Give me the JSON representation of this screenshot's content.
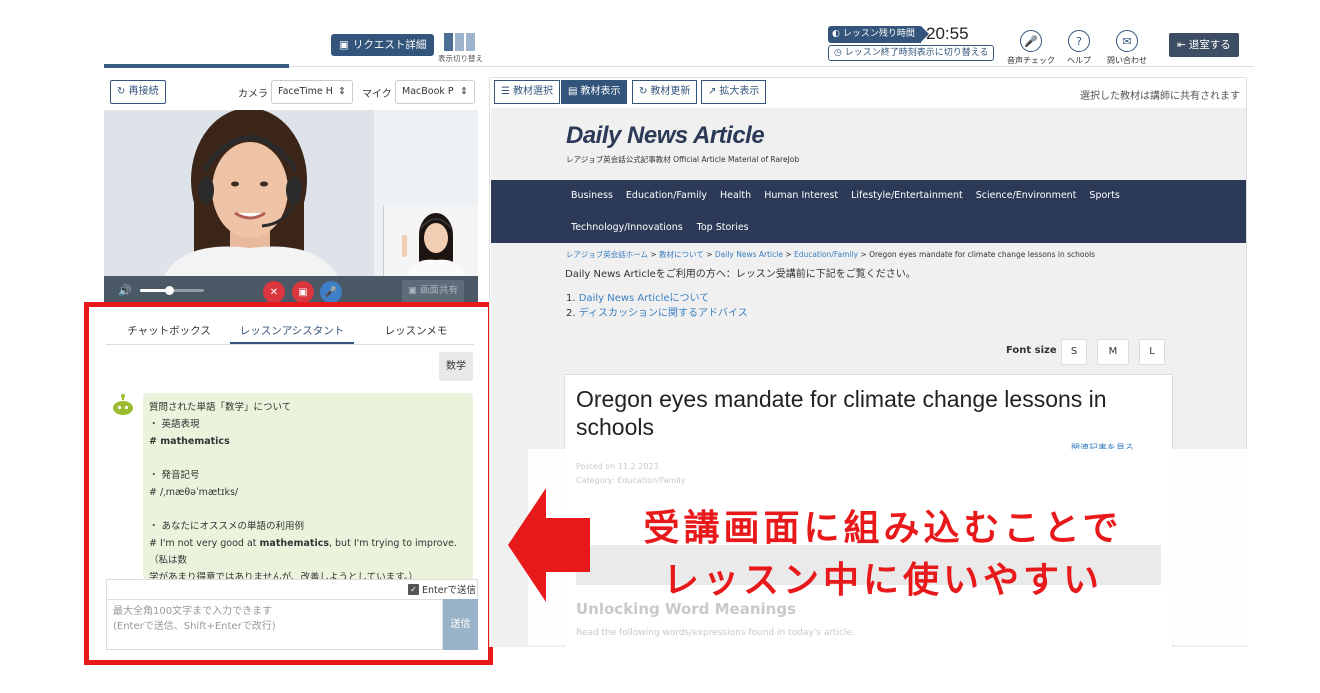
{
  "header": {
    "request_detail": "リクエスト詳細",
    "view_toggle": "表示切り替え",
    "remaining_label": "レッスン残り時間",
    "remaining_time": "20:55",
    "end_time_toggle": "レッスン終了時刻表示に切り替える",
    "audio_check": "音声チェック",
    "help": "ヘルプ",
    "contact": "問い合わせ",
    "exit": "退室する"
  },
  "video": {
    "reconnect": "再接続",
    "camera_label": "カメラ",
    "camera_value": "FaceTime H",
    "mic_label": "マイク",
    "mic_value": "MacBook P",
    "screen_share": "画面共有",
    "volume_level": 0.45
  },
  "chat": {
    "tabs": [
      "チャットボックス",
      "レッスンアシスタント",
      "レッスンメモ"
    ],
    "active_tab": "レッスンアシスタント",
    "user_message": "数学",
    "bot": {
      "line1": "質問された単語「数学」について",
      "line2": "・ 英語表現",
      "line3": "# mathematics",
      "line4": "・ 発音記号",
      "line5": "# /ˌmæθəˈmætɪks/",
      "line6": "・ あなたにオススメの単語の利用例",
      "line7_pre": "# I'm not very good at ",
      "line7_bold": "mathematics",
      "line7_post": ", but I'm trying to improve.（私は数",
      "line8": "学があまり得意ではありませんが、改善しようとしています。）"
    },
    "enter_send": "Enterで送信",
    "input_placeholder": "最大全角100文字まで入力できます\n(Enterで送信、Shift+Enterで改行)",
    "send": "送信"
  },
  "material": {
    "buttons": [
      "教材選択",
      "教材表示",
      "教材更新",
      "拡大表示"
    ],
    "share_note": "選択した教材は講師に共有されます",
    "logo": "Daily News Article",
    "logo_sub": "レアジョブ英会話公式記事教材   Official Article Material of RareJob",
    "categories_row1": [
      "Business",
      "Education/Family",
      "Health",
      "Human Interest",
      "Lifestyle/Entertainment",
      "Science/Environment",
      "Sports"
    ],
    "categories_row2": [
      "Technology/Innovations",
      "Top Stories"
    ],
    "breadcrumb": {
      "home": "レアジョブ英会話ホーム",
      "about": "教材について",
      "dna": "Daily News Article",
      "category": "Education/Family",
      "current": "Oregon eyes mandate for climate change lessons in schools"
    },
    "notice": "Daily News Articleをご利用の方へ：レッスン受講前に下記をご覧ください。",
    "guide": {
      "item1_num": "1.",
      "item1": "Daily News Articleについて",
      "item2_num": "2.",
      "item2": "ディスカッションに関するアドバイス"
    },
    "font_size_label": "Font size :",
    "font_sizes": [
      "S",
      "M",
      "L"
    ],
    "article_title": "Oregon eyes mandate for climate change lessons in schools",
    "article_link": "関連記事を見る",
    "ghost_date": "Posted on 11.2.2023",
    "ghost_category": "Category: Education/Family",
    "ghost_section": "Unlocking Word Meanings",
    "ghost_instruction": "Read the following words/expressions found in today's article."
  },
  "overlay": {
    "line1": "受講画面に組み込むことで",
    "line2": "レッスン中に使いやすい"
  },
  "colors": {
    "accent": "#34557b",
    "highlight_red": "#e8191b",
    "nav_bg": "#2c3a58",
    "bot_bubble": "#eaf4dc"
  }
}
